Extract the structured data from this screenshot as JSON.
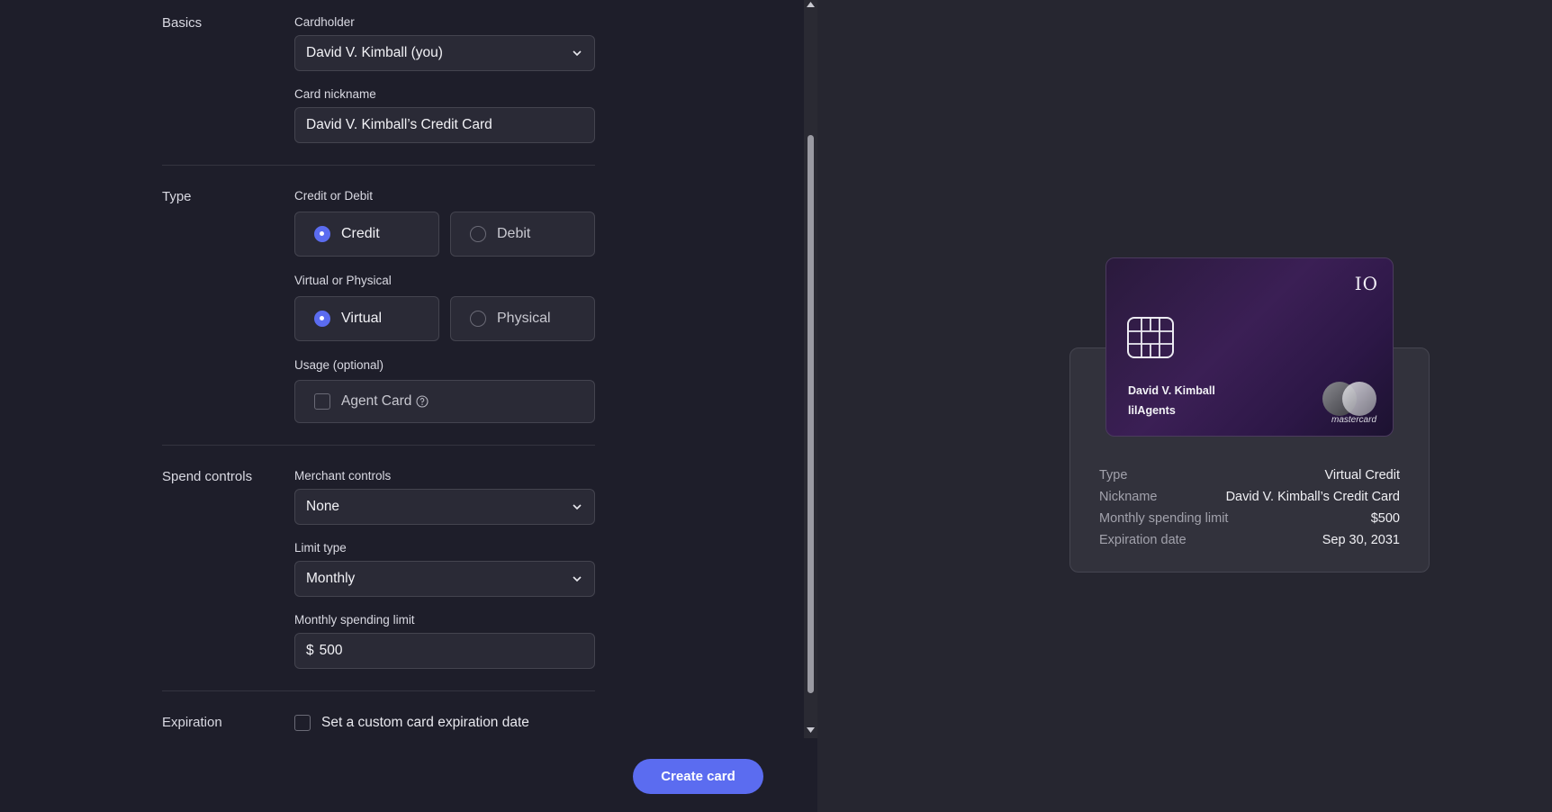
{
  "sections": {
    "basics": "Basics",
    "type": "Type",
    "spend_controls": "Spend controls",
    "expiration": "Expiration"
  },
  "basics": {
    "cardholder_label": "Cardholder",
    "cardholder_value": "David V. Kimball (you)",
    "nickname_label": "Card nickname",
    "nickname_value": "David V. Kimball’s Credit Card"
  },
  "type": {
    "credit_debit_label": "Credit or Debit",
    "credit": "Credit",
    "debit": "Debit",
    "virtual_physical_label": "Virtual or Physical",
    "virtual": "Virtual",
    "physical": "Physical",
    "usage_label": "Usage (optional)",
    "agent_card": "Agent Card"
  },
  "spend": {
    "merchant_label": "Merchant controls",
    "merchant_value": "None",
    "limit_type_label": "Limit type",
    "limit_type_value": "Monthly",
    "monthly_limit_label": "Monthly spending limit",
    "currency_symbol": "$",
    "monthly_limit_value": "500"
  },
  "expiration": {
    "custom_date_label": "Set a custom card expiration date"
  },
  "create_button": "Create card",
  "card_preview": {
    "brand": "IO",
    "holder": "David V. Kimball",
    "company": "lilAgents",
    "network": "mastercard"
  },
  "summary": [
    {
      "key": "Type",
      "value": "Virtual Credit"
    },
    {
      "key": "Nickname",
      "value": "David V. Kimball’s Credit Card"
    },
    {
      "key": "Monthly spending limit",
      "value": "$500"
    },
    {
      "key": "Expiration date",
      "value": "Sep 30, 2031"
    }
  ],
  "colors": {
    "accent": "#5b6cf0",
    "background": "#1e1e2a",
    "panel": "#262630"
  }
}
